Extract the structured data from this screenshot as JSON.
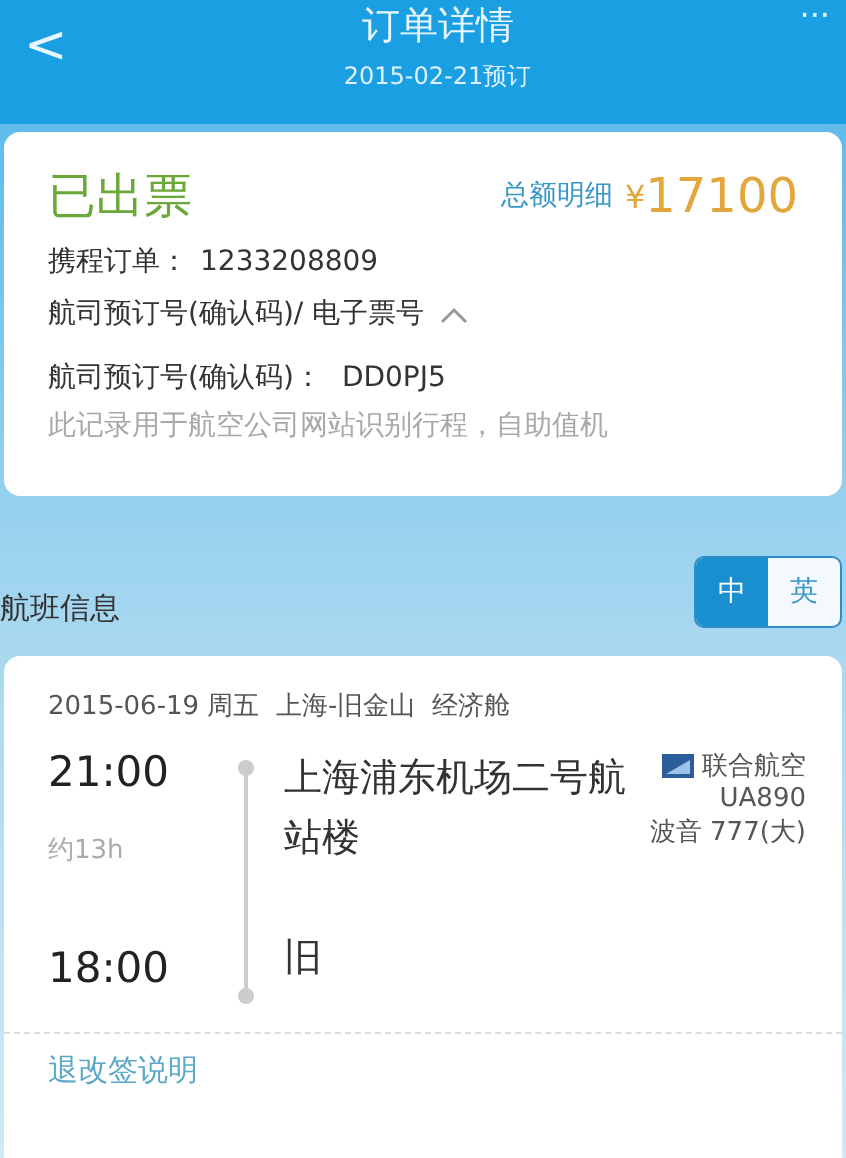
{
  "header": {
    "back": "<",
    "title": "订单详情",
    "subtitle": "2015-02-21预订",
    "more": "···"
  },
  "order": {
    "status": "已出票",
    "total_label": "总额明细",
    "currency": "¥",
    "total": "17100",
    "order_label": "携程订单：",
    "order_no": "1233208809",
    "pnr_toggle": "航司预订号(确认码)/ 电子票号",
    "expanded": true,
    "pnr_label": "航司预订号(确认码)：",
    "pnr": "DD0PJ5",
    "note": "此记录用于航空公司网站识别行程，自助值机"
  },
  "flight_section": {
    "title": "航班信息",
    "languages": [
      {
        "label": "中",
        "selected": true
      },
      {
        "label": "英",
        "selected": false
      }
    ]
  },
  "flight": {
    "summary": "2015-06-19 周五  上海-旧金山  经济舱",
    "depart_time": "21:00",
    "depart_airport": "上海浦东机场二号航站楼",
    "duration": "约13h",
    "arrive_time": "18:00",
    "arrive_airport": "旧",
    "airline": "联合航空",
    "flight_no": "UA890",
    "aircraft": "波音 777(大)"
  },
  "footer_link": "退改签说明"
}
